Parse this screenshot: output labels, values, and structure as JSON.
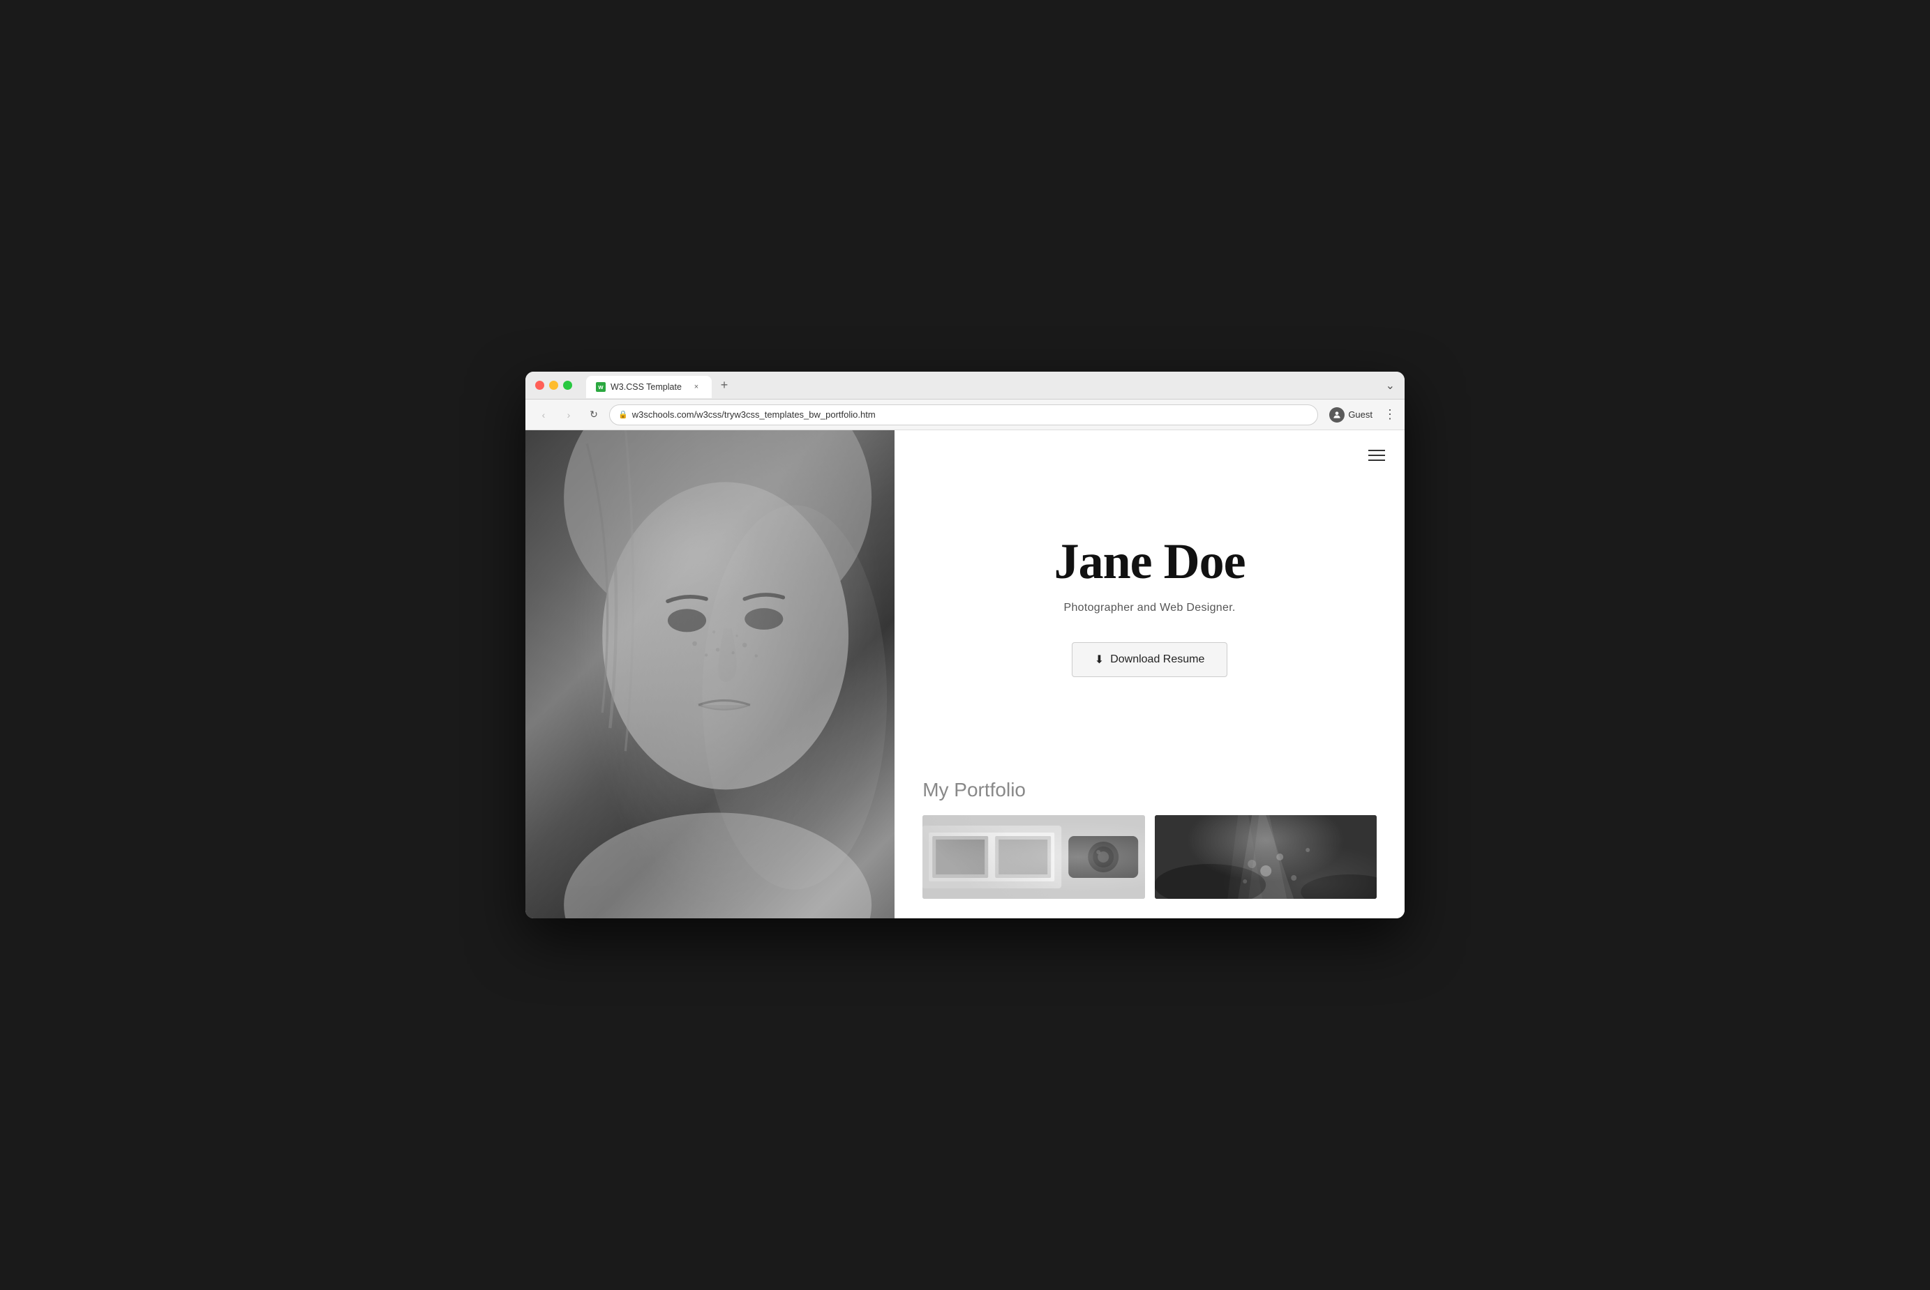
{
  "browser": {
    "tab_favicon": "w",
    "tab_title": "W3.CSS Template",
    "tab_close": "×",
    "new_tab": "+",
    "tab_bar_chevron": "⌄",
    "nav_back": "‹",
    "nav_forward": "›",
    "nav_reload": "↻",
    "url_lock": "🔒",
    "url": "w3schools.com/w3css/tryw3css_templates_bw_portfolio.htm",
    "profile_icon": "👤",
    "profile_label": "Guest",
    "menu": "⋮"
  },
  "hamburger_menu": "≡",
  "hero": {
    "name": "Jane Doe",
    "subtitle": "Photographer and Web Designer.",
    "download_button": "Download Resume",
    "download_icon": "⬇"
  },
  "portfolio": {
    "title": "My Portfolio"
  },
  "colors": {
    "accent": "#333",
    "button_bg": "#f5f5f5",
    "subtitle_color": "#555",
    "portfolio_title_color": "#888"
  }
}
